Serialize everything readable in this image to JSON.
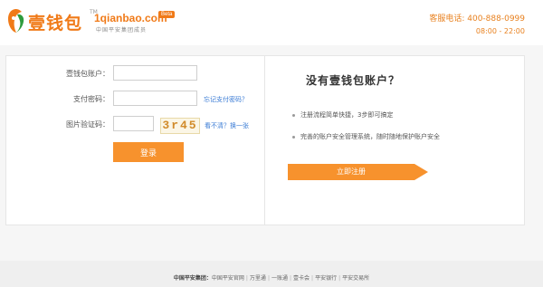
{
  "header": {
    "logo_text": "壹钱包",
    "logo_tm": "TM",
    "logo_domain": "1qianbao.com",
    "logo_beta": "Beta",
    "logo_slogan": "中国平安集团成员",
    "hotline": "客服电话: 400-888-0999",
    "hours": "08:00 - 22:00"
  },
  "login": {
    "account_label": "壹钱包账户：",
    "account_value": "",
    "password_label": "支付密码：",
    "password_value": "",
    "forgot_link": "忘记支付密码？",
    "captcha_label": "图片验证码：",
    "captcha_value": "",
    "captcha_text": "3r45",
    "refresh_link": "看不清？换一张",
    "submit_label": "登录"
  },
  "register": {
    "title": "没有壹钱包账户？",
    "features": [
      "注册流程简单快捷，3步即可搞定",
      "完善的账户安全管理系统，随时随地保护账户安全"
    ],
    "button_label": "立即注册"
  },
  "footer": {
    "group_label": "中国平安集团：",
    "links": [
      "中国平安官网",
      "万里通",
      "一账通",
      "壹卡会",
      "平安银行",
      "平安交易所"
    ]
  },
  "colors": {
    "accent": "#f7922d",
    "link": "#3a7bd5"
  }
}
